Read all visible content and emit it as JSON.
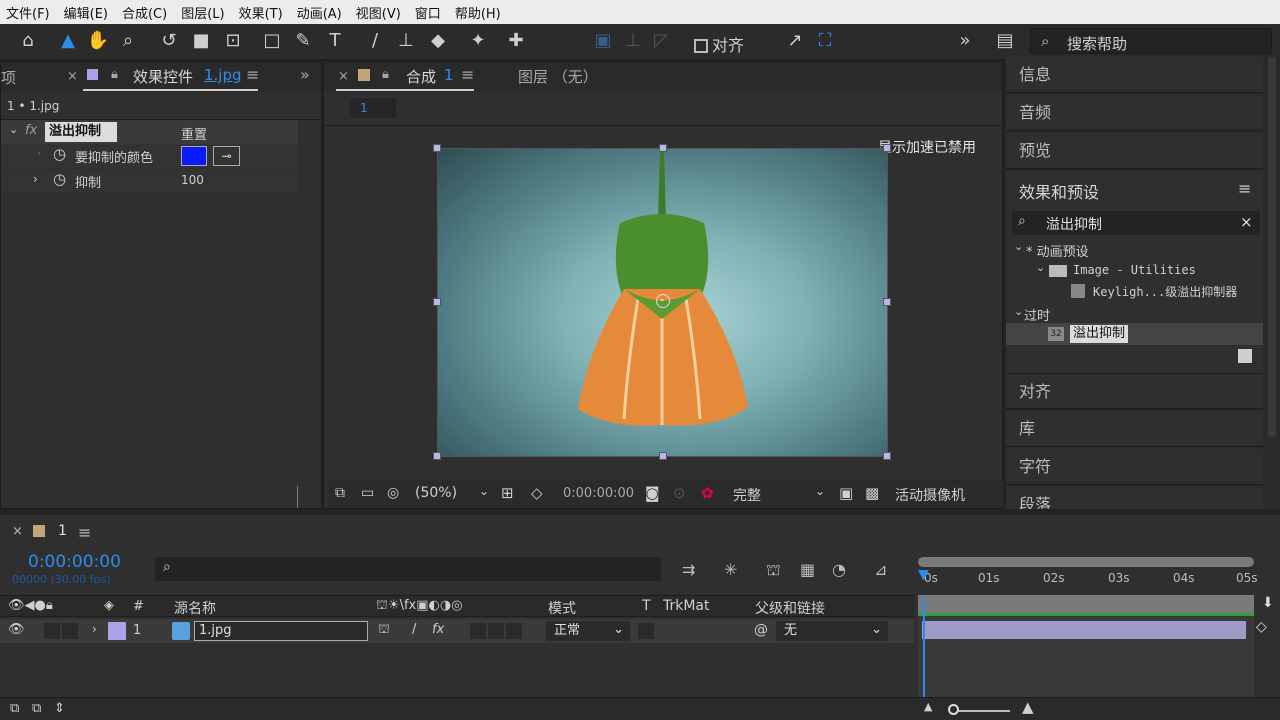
{
  "menu": [
    "文件(F)",
    "编辑(E)",
    "合成(C)",
    "图层(L)",
    "效果(T)",
    "动画(A)",
    "视图(V)",
    "窗口",
    "帮助(H)"
  ],
  "toolbar": {
    "align_label": "对齐",
    "search_help": "搜索帮助"
  },
  "effects_panel": {
    "tab_prefix": "项目",
    "tab_title": "效果控件",
    "tab_file": "1.jpg",
    "layer_path": "1 • 1.jpg",
    "fx_label": "fx",
    "effect_name": "溢出抑制",
    "reset_label": "重置",
    "prop1": "要抑制的颜色",
    "prop2": "抑制",
    "prop2_value": "100",
    "swatch_color": "#0a1bff"
  },
  "comp_panel": {
    "tab_title": "合成",
    "tab_num": "1",
    "layer_tab": "图层 （无）",
    "breadcrumb": "1",
    "gpu_notice": "显示加速已禁用",
    "zoom": "(50%)",
    "time": "0:00:00:00",
    "quality": "完整",
    "camera": "活动摄像机"
  },
  "right_panels": {
    "info": "信息",
    "audio": "音频",
    "preview": "预览",
    "effects_presets": "效果和预设",
    "search_value": "溢出抑制",
    "tree": {
      "anim_presets": "* 动画预设",
      "image_utilities": "Image - Utilities",
      "keylight": "Keyligh...级溢出抑制器",
      "obsolete": "过时",
      "spill": "溢出抑制",
      "spill_badge": "32"
    },
    "align": "对齐",
    "library": "库",
    "character": "字符",
    "paragraph": "段落"
  },
  "timeline": {
    "tab": "1",
    "timecode": "0:00:00:00",
    "fps_info": "00000 (30.00 fps)",
    "cols": {
      "num": "#",
      "source": "源名称",
      "mode": "模式",
      "t": "T",
      "trkmat": "TrkMat",
      "parent": "父级和链接"
    },
    "layer": {
      "num": "1",
      "name": "1.jpg",
      "mode": "正常",
      "parent": "无"
    },
    "ruler": [
      "0s",
      "01s",
      "02s",
      "03s",
      "04s",
      "05s"
    ]
  }
}
